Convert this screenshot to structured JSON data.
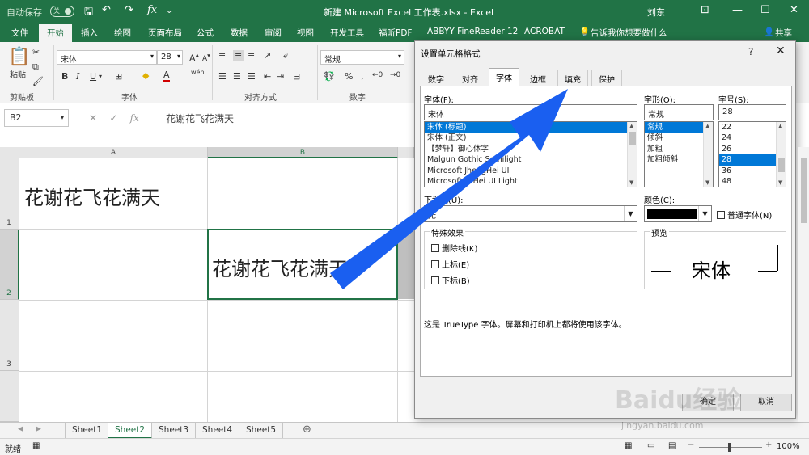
{
  "titlebar": {
    "autosave_label": "自动保存",
    "autosave_state": "关",
    "document_title": "新建 Microsoft Excel 工作表.xlsx  -  Excel",
    "user": "刘东"
  },
  "ribbon_tabs": [
    "文件",
    "开始",
    "插入",
    "绘图",
    "页面布局",
    "公式",
    "数据",
    "审阅",
    "视图",
    "开发工具",
    "福昕PDF",
    "ABBYY FineReader 12",
    "ACROBAT",
    "告诉我你想要做什么"
  ],
  "ribbon_share": "共享",
  "ribbon": {
    "paste_label": "粘贴",
    "clipboard_group": "剪贴板",
    "font_group": "字体",
    "align_group": "对齐方式",
    "number_group": "数字",
    "font_name": "宋体",
    "font_size": "28",
    "number_format": "常规",
    "bold": "B",
    "italic": "I",
    "underline": "U",
    "font_color_glyph": "A",
    "wen_glyph": "wén"
  },
  "formula_bar": {
    "name_box": "B2",
    "content": "花谢花飞花满天"
  },
  "grid": {
    "columns": [
      "A",
      "B"
    ],
    "rows": [
      "1",
      "2",
      "3"
    ],
    "cell_a1": "花谢花飞花满天",
    "cell_b2": "花谢花飞花满天"
  },
  "sheets": [
    "Sheet1",
    "Sheet2",
    "Sheet3",
    "Sheet4",
    "Sheet5"
  ],
  "active_sheet": "Sheet2",
  "status": {
    "ready": "就绪",
    "zoom": "100%"
  },
  "dialog": {
    "title": "设置单元格格式",
    "help": "?",
    "close": "✕",
    "tabs": [
      "数字",
      "对齐",
      "字体",
      "边框",
      "填充",
      "保护"
    ],
    "active_tab": "字体",
    "font_label": "字体(F):",
    "font_value": "宋体",
    "font_list": [
      "宋体 (标题)",
      "宋体 (正文)",
      "【梦轩】御心体字",
      "Malgun Gothic Semilight",
      "Microsoft JhengHei UI",
      "Microsoft YaHei UI Light"
    ],
    "style_label": "字形(O):",
    "style_value": "常规",
    "style_list": [
      "常规",
      "倾斜",
      "加粗",
      "加粗倾斜"
    ],
    "size_label": "字号(S):",
    "size_value": "28",
    "size_list": [
      "22",
      "24",
      "26",
      "28",
      "36",
      "48"
    ],
    "underline_label": "下划线(U):",
    "underline_value": "无",
    "color_label": "颜色(C):",
    "normal_font_label": "普通字体(N)",
    "effects_label": "特殊效果",
    "effects": [
      "删除线(K)",
      "上标(E)",
      "下标(B)"
    ],
    "preview_label": "预览",
    "preview_text": "宋体",
    "footnote": "这是 TrueType 字体。屏幕和打印机上都将使用该字体。",
    "ok_label": "确定",
    "cancel_label": "取消"
  },
  "watermark": {
    "brand": "Baidu经验",
    "url": "jingyan.baidu.com"
  },
  "colors": {
    "excel_green": "#217346",
    "selection_blue": "#0078d7",
    "arrow_blue": "#1a5ff0"
  }
}
